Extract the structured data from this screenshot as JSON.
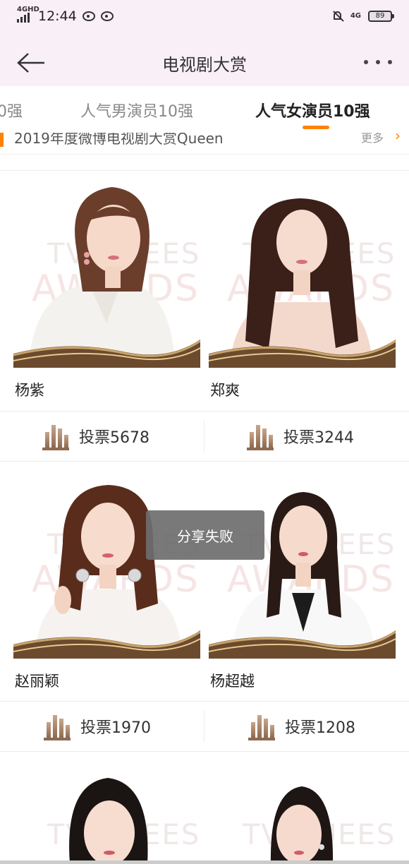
{
  "status_bar": {
    "network_left": "4GHD",
    "time": "12:44",
    "network_right": "4G",
    "battery": "89"
  },
  "nav": {
    "title": "电视剧大赏"
  },
  "tabs": [
    {
      "label": "0强"
    },
    {
      "label": "人气男演员10强"
    },
    {
      "label": "人气女演员10强"
    }
  ],
  "banner": {
    "text": "2019年度微博电视剧大赏Queen",
    "more": "更多",
    "arrow": "›"
  },
  "watermark": {
    "line1": "TV QUEES",
    "line2": "AWARDS"
  },
  "actors": [
    {
      "name": "杨紫",
      "vote": "投票5678"
    },
    {
      "name": "郑爽",
      "vote": "投票3244"
    },
    {
      "name": "赵丽颖",
      "vote": "投票1970"
    },
    {
      "name": "杨超越",
      "vote": "投票1208"
    }
  ],
  "toast": "分享失败",
  "colors": {
    "accent": "#ff8200",
    "header_bg": "#f8f0f6",
    "gold": "#8d6a50"
  }
}
